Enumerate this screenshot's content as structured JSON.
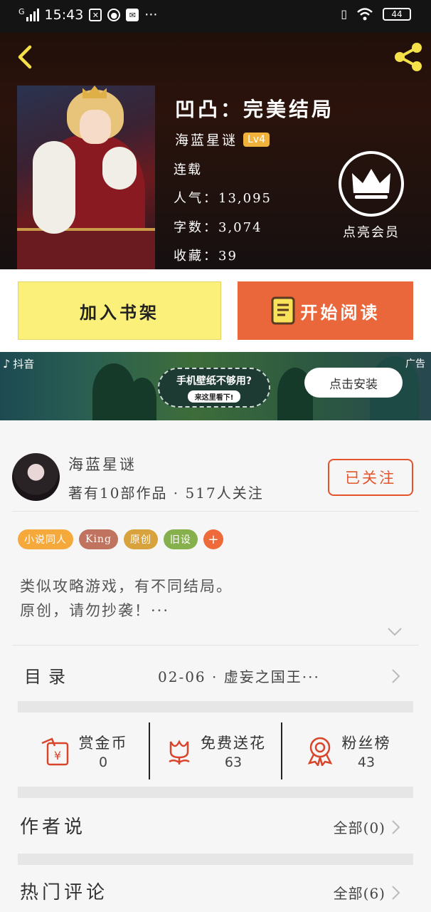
{
  "status_bar": {
    "network": "G",
    "time": "15:43",
    "battery": "44"
  },
  "book": {
    "title": "凹凸：完美结局",
    "author": "海蓝星谜",
    "level": "Lv4",
    "status": "连载",
    "popularity_label": "人气：",
    "popularity": "13,095",
    "words_label": "字数：",
    "words": "3,074",
    "favorites_label": "收藏：",
    "favorites": "39"
  },
  "vip": {
    "label": "点亮会员"
  },
  "actions": {
    "add_shelf": "加入书架",
    "start_read": "开始阅读"
  },
  "ad": {
    "source": "抖音",
    "tag": "广告",
    "headline": "手机壁纸不够用?",
    "subline": "来这里看下!",
    "install": "点击安装"
  },
  "author_panel": {
    "name": "海蓝星谜",
    "stats": "著有10部作品 · 517人关注",
    "follow": "已关注"
  },
  "tags": [
    {
      "label": "小说同人",
      "color": "#f4a93a"
    },
    {
      "label": "King",
      "color": "#c0735e"
    },
    {
      "label": "原创",
      "color": "#d8a23c"
    },
    {
      "label": "旧设",
      "color": "#86b04c"
    }
  ],
  "tag_add": "+",
  "description": {
    "line1": "类似攻略游戏，有不同结局。",
    "line2": "原创，请勿抄袭！···"
  },
  "toc": {
    "title": "目录",
    "latest": "02-06  ·  虚妄之国王···"
  },
  "stats": [
    {
      "label": "赏金币",
      "value": "0"
    },
    {
      "label": "免费送花",
      "value": "63"
    },
    {
      "label": "粉丝榜",
      "value": "43"
    }
  ],
  "author_says": {
    "title": "作者说",
    "more": "全部(0)"
  },
  "hot_comments": {
    "title": "热门评论",
    "more": "全部(6)"
  },
  "colors": {
    "accent_orange": "#e9673a",
    "follow_red": "#e4532c",
    "shelf_yellow": "#fbf07a",
    "icon_yellow": "#f5e04a",
    "stat_icon_red": "#d9452b"
  }
}
